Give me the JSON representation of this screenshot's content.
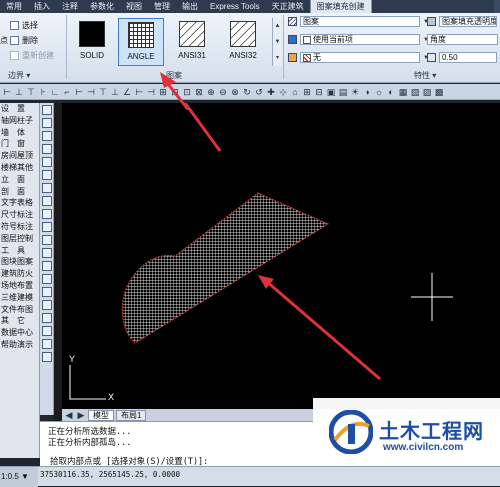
{
  "menubar": {
    "tabs": [
      "常用",
      "插入",
      "注释",
      "参数化",
      "视图",
      "管理",
      "输出",
      "Express Tools",
      "天正建筑",
      "图案填充创建"
    ],
    "active_tab": "图案填充创建"
  },
  "ribbon": {
    "boundary": {
      "left_stub": "点",
      "select": "选择",
      "remove": "删除",
      "recreate": "重新创建",
      "label": "边界 ▾"
    },
    "pattern": {
      "label": "图案",
      "swatches": [
        {
          "name": "SOLID",
          "style": "solid"
        },
        {
          "name": "ANGLE",
          "style": "grid",
          "selected": true
        },
        {
          "name": "ANSI31",
          "style": "diag"
        },
        {
          "name": "ANSI32",
          "style": "diag"
        }
      ],
      "scroll_up": "▲",
      "scroll_down": "▼",
      "scroll_more": "▾"
    },
    "properties": {
      "hatch_type": "图案",
      "use_current": "使用当前项",
      "background": "无",
      "transparency_label": "图案填充透明度",
      "angle_label": "角度",
      "angle_value": "0",
      "scale_value": "0.50",
      "label": "特性 ▾"
    }
  },
  "sidepanel": {
    "items": [
      "设　置",
      "轴网柱子",
      "墙　体",
      "门　窗",
      "房间屋顶",
      "楼梯其他",
      "立　面",
      "剖　面",
      "文字表格",
      "尺寸标注",
      "符号标注",
      "图层控制",
      "工　具",
      "图块图案",
      "建筑防火",
      "场地布置",
      "三维建模",
      "文件布图",
      "其　它",
      "数据中心",
      "帮助演示"
    ]
  },
  "layout_tabs": [
    "模型",
    "布局1"
  ],
  "cmdline": {
    "line1": "正在分析所选数据...",
    "line2": "正在分析内部孤岛...",
    "prompt": "拾取内部点或 [选择对象(S)/设置(T)]:"
  },
  "status": {
    "scale": "1:0.5 ▼",
    "coords": "37530116.35, 2565145.25, 0.0000"
  },
  "ucs": {
    "x": "X",
    "y": "Y"
  },
  "watermark": {
    "brand": "土木工程网",
    "url": "www.civilcn.com"
  },
  "colors": {
    "arrow": "#e0303a",
    "hatch_boundary": "#d04040",
    "menubar": "#2e3b4e",
    "brand": "#1d4ea3"
  }
}
